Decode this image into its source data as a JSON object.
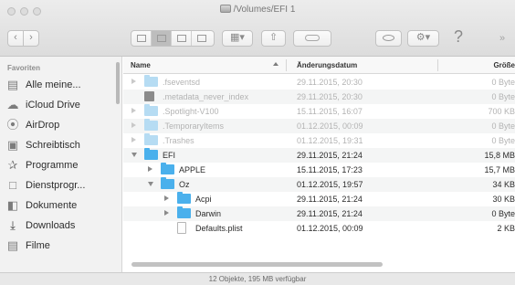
{
  "window": {
    "title": "/Volumes/EFI 1"
  },
  "toolbar": {
    "back_icon": "chevron-left-icon",
    "forward_icon": "chevron-right-icon",
    "help_label": "?",
    "overflow_label": "»"
  },
  "sidebar": {
    "heading": "Favoriten",
    "items": [
      {
        "label": "Alle meine...",
        "icon": "all-files-icon"
      },
      {
        "label": "iCloud Drive",
        "icon": "cloud-icon"
      },
      {
        "label": "AirDrop",
        "icon": "airdrop-icon"
      },
      {
        "label": "Schreibtisch",
        "icon": "desktop-icon"
      },
      {
        "label": "Programme",
        "icon": "applications-icon"
      },
      {
        "label": "Dienstprogr...",
        "icon": "utilities-folder-icon"
      },
      {
        "label": "Dokumente",
        "icon": "documents-icon"
      },
      {
        "label": "Downloads",
        "icon": "downloads-icon"
      },
      {
        "label": "Filme",
        "icon": "movies-icon"
      }
    ]
  },
  "list": {
    "columns": {
      "name": "Name",
      "date": "Änderungsdatum",
      "size": "Größe"
    },
    "rows": [
      {
        "name": ".fseventsd",
        "date": "29.11.2015, 20:30",
        "size": "0 Byte",
        "dim": true,
        "kind": "folder",
        "disclosure": "closed",
        "indent": 0
      },
      {
        "name": ".metadata_never_index",
        "date": "29.11.2015, 20:30",
        "size": "0 Byte",
        "dim": true,
        "kind": "doc",
        "disclosure": "none",
        "indent": 0
      },
      {
        "name": ".Spotlight-V100",
        "date": "15.11.2015, 16:07",
        "size": "700 KB",
        "dim": true,
        "kind": "folder",
        "disclosure": "closed",
        "indent": 0
      },
      {
        "name": ".TemporaryItems",
        "date": "01.12.2015, 00:09",
        "size": "0 Byte",
        "dim": true,
        "kind": "folder",
        "disclosure": "closed",
        "indent": 0
      },
      {
        "name": ".Trashes",
        "date": "01.12.2015, 19:31",
        "size": "0 Byte",
        "dim": true,
        "kind": "folder",
        "disclosure": "closed",
        "indent": 0
      },
      {
        "name": "EFI",
        "date": "29.11.2015, 21:24",
        "size": "15,8 MB",
        "dim": false,
        "kind": "folder",
        "disclosure": "open",
        "indent": 0
      },
      {
        "name": "APPLE",
        "date": "15.11.2015, 17:23",
        "size": "15,7 MB",
        "dim": false,
        "kind": "folder",
        "disclosure": "closed",
        "indent": 1
      },
      {
        "name": "Oz",
        "date": "01.12.2015, 19:57",
        "size": "34 KB",
        "dim": false,
        "kind": "folder",
        "disclosure": "open",
        "indent": 1
      },
      {
        "name": "Acpi",
        "date": "29.11.2015, 21:24",
        "size": "30 KB",
        "dim": false,
        "kind": "folder",
        "disclosure": "closed",
        "indent": 2
      },
      {
        "name": "Darwin",
        "date": "29.11.2015, 21:24",
        "size": "0 Byte",
        "dim": false,
        "kind": "folder",
        "disclosure": "closed",
        "indent": 2
      },
      {
        "name": "Defaults.plist",
        "date": "01.12.2015, 00:09",
        "size": "2 KB",
        "dim": false,
        "kind": "file",
        "disclosure": "none",
        "indent": 2
      }
    ]
  },
  "status": {
    "text": "12 Objekte, 195 MB verfügbar"
  }
}
